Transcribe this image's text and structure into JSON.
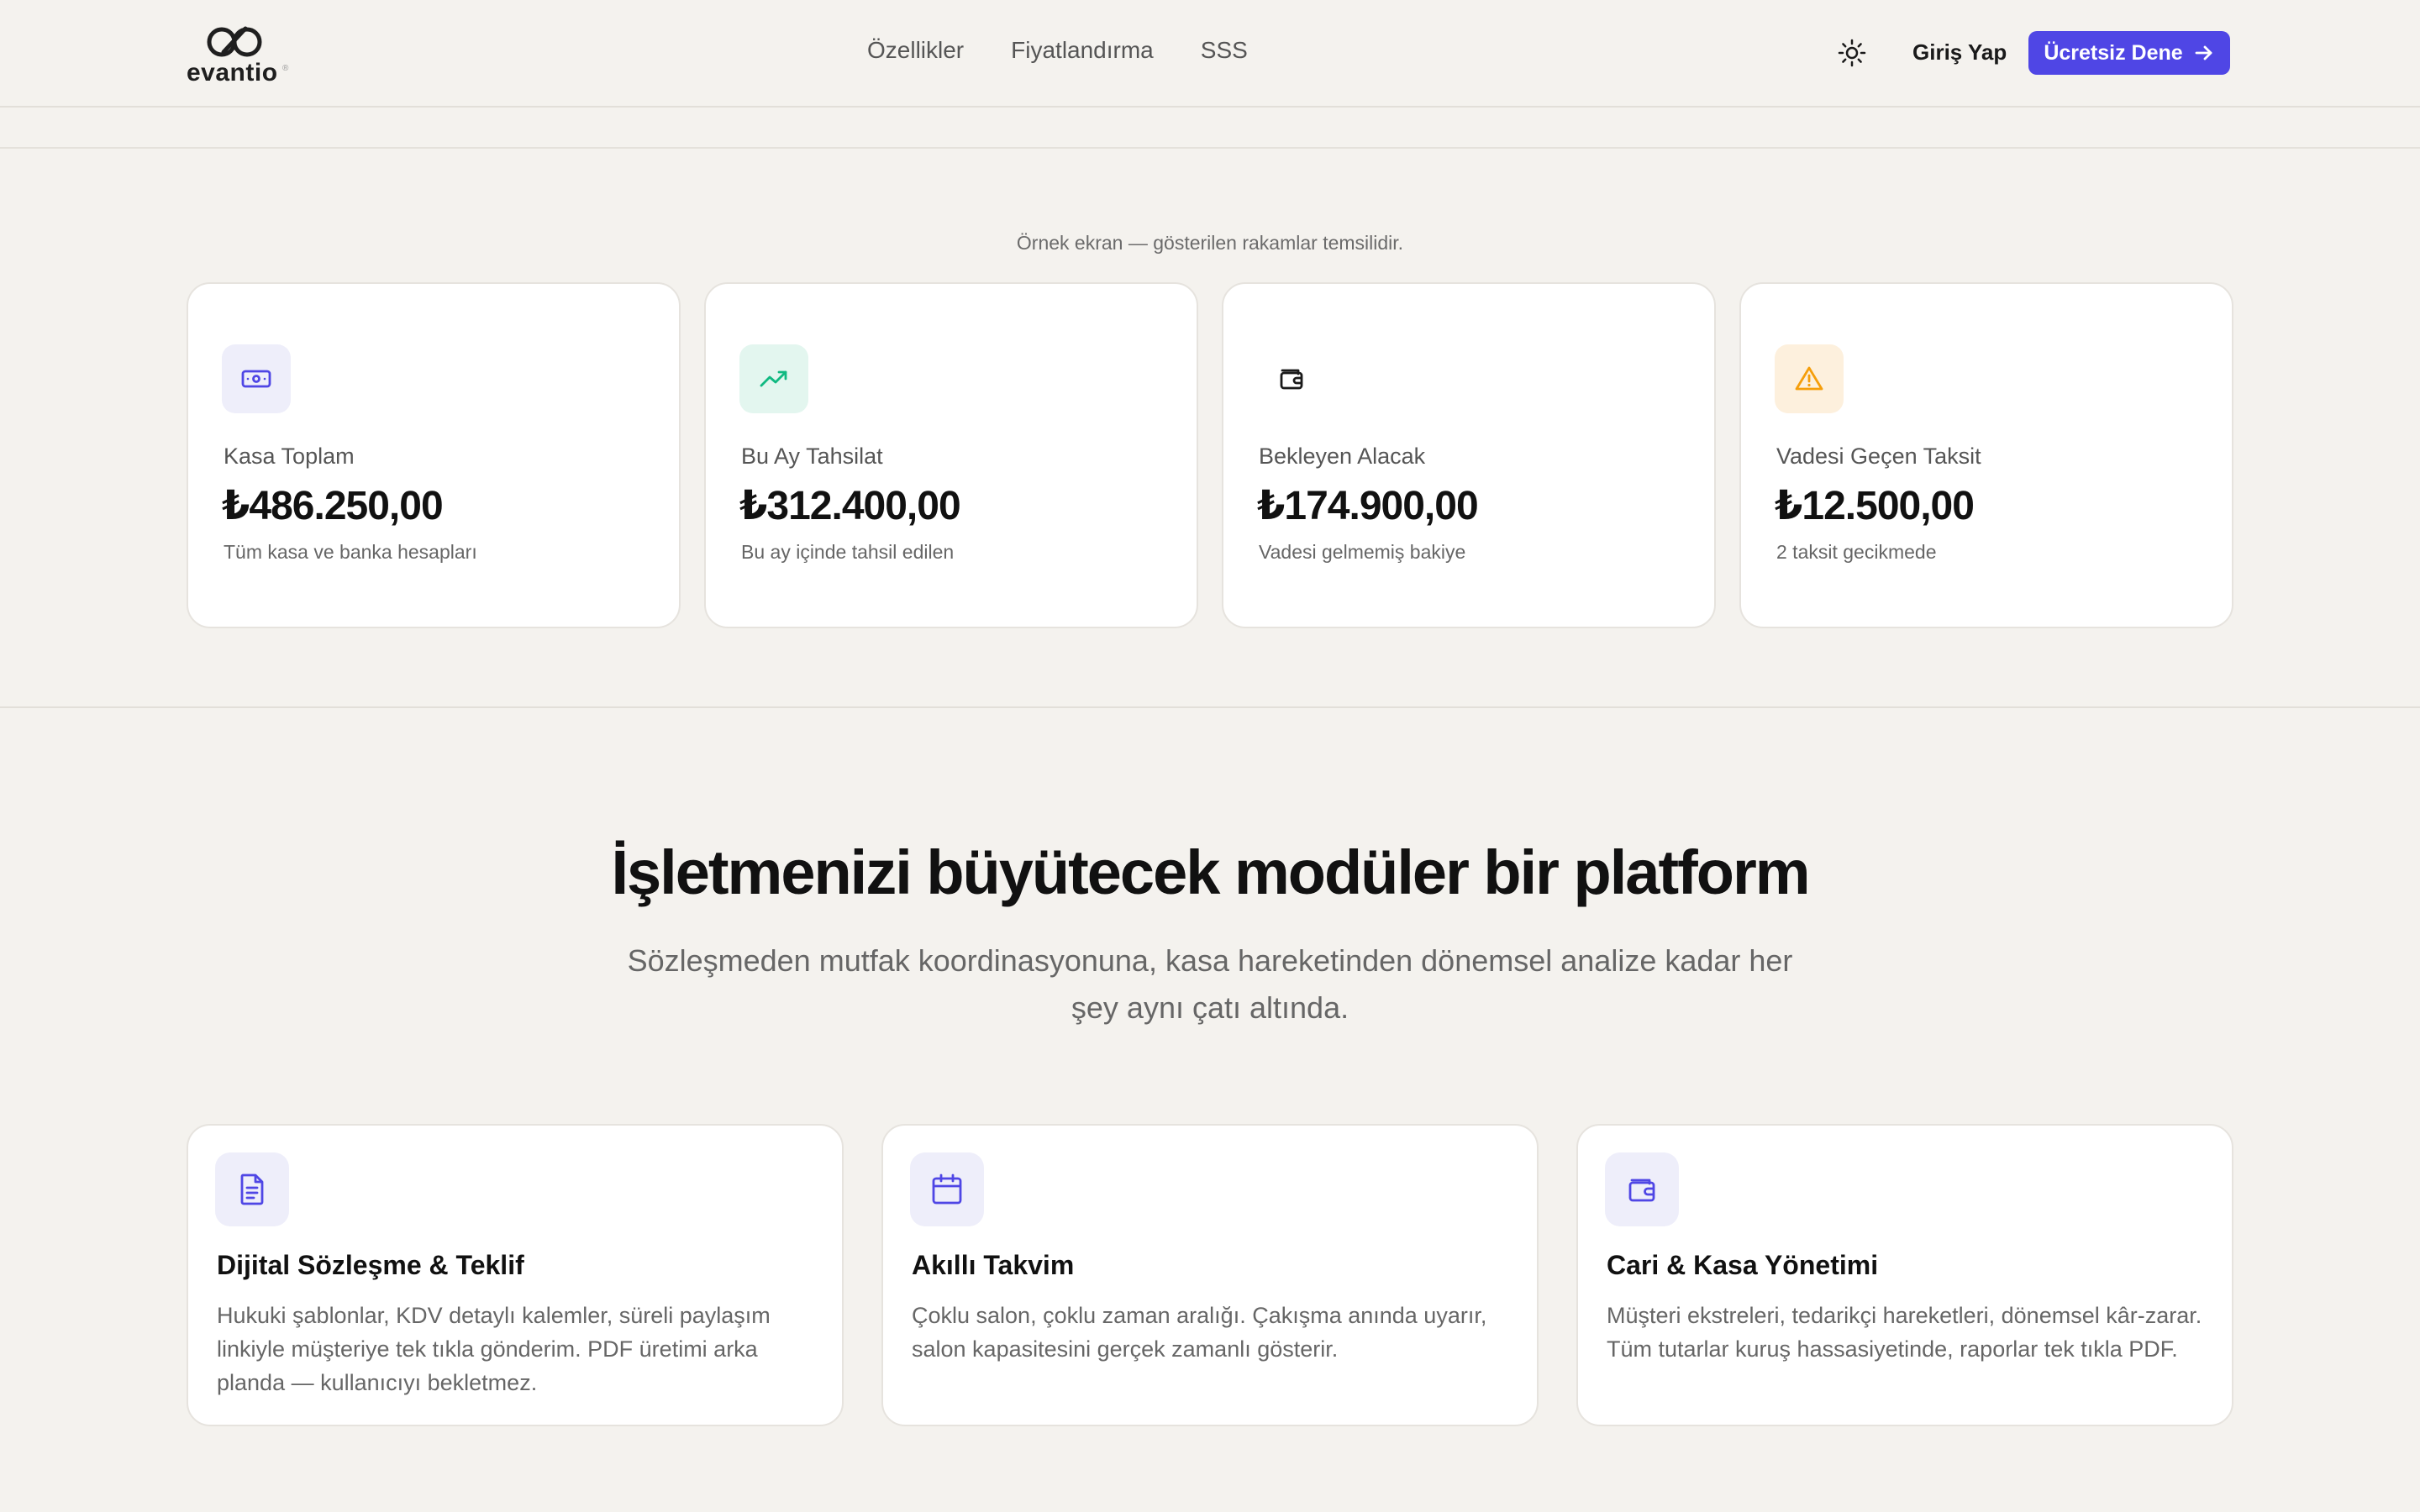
{
  "header": {
    "logo_text": "evantio",
    "logo_reg": "®",
    "nav": [
      "Özellikler",
      "Fiyatlandırma",
      "SSS"
    ],
    "login_label": "Giriş Yap",
    "cta_label": "Ücretsiz Dene"
  },
  "stats": {
    "note": "Örnek ekran — gösterilen rakamlar temsilidir.",
    "cards": [
      {
        "icon": "banknote-icon",
        "label": "Kasa Toplam",
        "value": "₺486.250,00",
        "sub": "Tüm kasa ve banka hesapları",
        "icon_bg": "#eeeefa",
        "icon_color": "#4f46e5"
      },
      {
        "icon": "trending-up-icon",
        "label": "Bu Ay Tahsilat",
        "value": "₺312.400,00",
        "sub": "Bu ay içinde tahsil edilen",
        "icon_bg": "#e3f6ef",
        "icon_color": "#10b981"
      },
      {
        "icon": "wallet-icon",
        "label": "Bekleyen Alacak",
        "value": "₺174.900,00",
        "sub": "Vadesi gelmemiş bakiye",
        "icon_bg": "#ffffff",
        "icon_color": "#1a1a1a"
      },
      {
        "icon": "warning-icon",
        "label": "Vadesi Geçen Taksit",
        "value": "₺12.500,00",
        "sub": "2 taksit gecikmede",
        "icon_bg": "#fdf0dd",
        "icon_color": "#f59e0b"
      }
    ]
  },
  "features": {
    "title": "İşletmenizi büyütecek modüler bir platform",
    "subtitle": "Sözleşmeden mutfak koordinasyonuna, kasa hareketinden dönemsel analize kadar her şey aynı çatı altında.",
    "cards": [
      {
        "icon": "document-icon",
        "title": "Dijital Sözleşme & Teklif",
        "desc": "Hukuki şablonlar, KDV detaylı kalemler, süreli paylaşım linkiyle müşteriye tek tıkla gönderim. PDF üretimi arka planda — kullanıcıyı bekletmez."
      },
      {
        "icon": "calendar-icon",
        "title": "Akıllı Takvim",
        "desc": "Çoklu salon, çoklu zaman aralığı. Çakışma anında uyarır, salon kapasitesini gerçek zamanlı gösterir."
      },
      {
        "icon": "wallet-icon",
        "title": "Cari & Kasa Yönetimi",
        "desc": "Müşteri ekstreleri, tedarikçi hareketleri, dönemsel kâr-zarar. Tüm tutarlar kuruş hassasiyetinde, raporlar tek tıkla PDF."
      }
    ]
  },
  "colors": {
    "accent": "#4f46e5",
    "background": "#f4f2ee"
  }
}
